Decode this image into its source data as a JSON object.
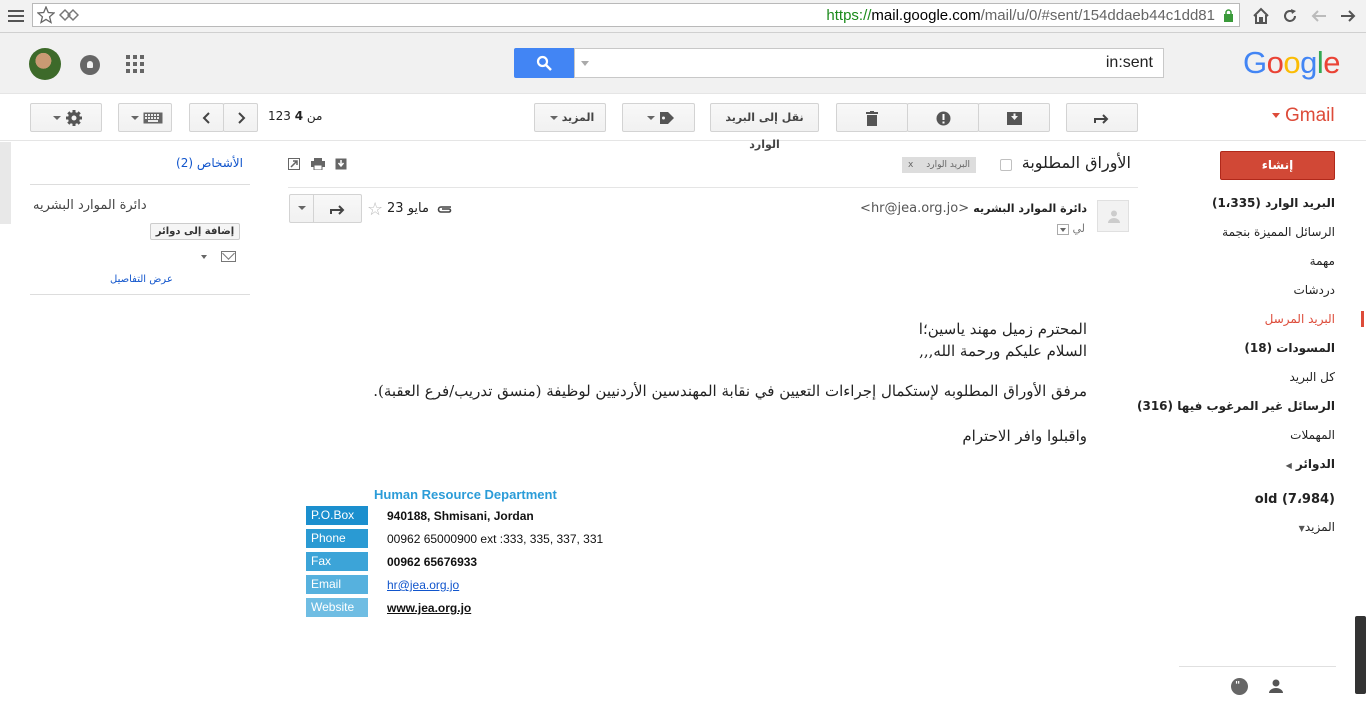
{
  "browser": {
    "url_scheme": "https://",
    "url_host": "mail.google.com",
    "url_path": "/mail/u/0/#sent/154ddaeb44c1dd81",
    "icons": [
      "menu-icon",
      "star-icon",
      "extension-icon",
      "lock-icon",
      "home-icon",
      "reload-icon",
      "back-icon",
      "forward-icon"
    ]
  },
  "header": {
    "search_value": "in:sent",
    "logo": "Google",
    "colors": {
      "blue": "#4285f4",
      "red": "#ea4335",
      "yellow": "#fbbc05",
      "green": "#34a853"
    }
  },
  "toolbar": {
    "gmail_label": "Gmail",
    "move_to_inbox": "نقل إلى البريد الوارد",
    "more": "المزيد",
    "pager_current": "4",
    "pager_of": "من",
    "pager_total": "123"
  },
  "nav": {
    "compose": "إنشاء",
    "items": [
      {
        "label": "البريد الوارد (1،335)",
        "bold": true,
        "active": false
      },
      {
        "label": "الرسائل المميزة بنجمة",
        "bold": false,
        "active": false
      },
      {
        "label": "مهمة",
        "bold": false,
        "active": false
      },
      {
        "label": "دردشات",
        "bold": false,
        "active": false
      },
      {
        "label": "البريد المرسل",
        "bold": false,
        "active": true
      },
      {
        "label": "المسودات (18)",
        "bold": true,
        "active": false
      },
      {
        "label": "كل البريد",
        "bold": false,
        "active": false
      },
      {
        "label": "الرسائل غير المرغوب فيها (316)",
        "bold": true,
        "active": false
      },
      {
        "label": "المهملات",
        "bold": false,
        "active": false
      },
      {
        "label": "الدوائر",
        "bold": true,
        "active": false
      },
      {
        "label": "old (7،984)",
        "bold": true,
        "active": false
      },
      {
        "label": "المزيد",
        "bold": false,
        "active": false
      }
    ]
  },
  "people": {
    "link": "الأشخاص (2)",
    "contact_name": "دائرة الموارد البشريه",
    "add_to_circles": "إضافة إلى دوائر",
    "view_details": "عرض التفاصيل"
  },
  "message": {
    "subject": "الأوراق المطلوبة",
    "inbox_tag": "البريد الوارد",
    "tag_remove": "x",
    "sender_name": "دائرة الموارد البشريه",
    "sender_email": "<hr@jea.org.jo>",
    "to": "لي",
    "date": "23 مايو",
    "body": [
      "المحترم زميل مهند ياسين؛ا",
      "السلام عليكم ورحمة الله,,,",
      "مرفق الأوراق المطلوبه لإستكمال إجراءات التعيين في نقابة المهندسين الأردنيين لوظيفة (منسق تدريب/فرع العقبة).",
      "واقبلوا وافر الاحترام"
    ]
  },
  "signature": {
    "title": "Human Resource Department",
    "rows": [
      {
        "label": "P.O.Box",
        "value": "940188, Shmisani, Jordan",
        "color": "#1b8fce"
      },
      {
        "label": "Phone",
        "value": "00962 65000900 ext :333, 335, 337, 331",
        "color": "#2a9ad3"
      },
      {
        "label": "Fax",
        "value": "00962 65676933",
        "color": "#3ca4d8"
      },
      {
        "label": "Email",
        "value": "hr@jea.org.jo",
        "color": "#56b1de"
      },
      {
        "label": "Website",
        "value": "www.jea.org.jo",
        "color": "#6fbde3"
      }
    ]
  }
}
